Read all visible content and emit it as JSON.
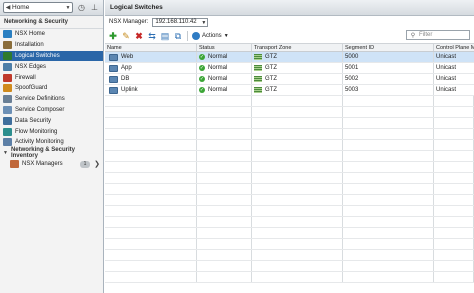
{
  "nav": {
    "home_label": "Home",
    "section_title": "Networking & Security",
    "items": [
      {
        "label": "NSX Home",
        "icon": "nsx-home-icon",
        "color": "#2a7fc1"
      },
      {
        "label": "Installation",
        "icon": "installation-icon",
        "color": "#8a6d3b"
      },
      {
        "label": "Logical Switches",
        "icon": "logical-switches-icon",
        "color": "#2e7a2e"
      },
      {
        "label": "NSX Edges",
        "icon": "nsx-edges-icon",
        "color": "#4d7ea8"
      },
      {
        "label": "Firewall",
        "icon": "firewall-icon",
        "color": "#c0392b"
      },
      {
        "label": "SpoofGuard",
        "icon": "spoofguard-icon",
        "color": "#d08a1c"
      },
      {
        "label": "Service Definitions",
        "icon": "service-definitions-icon",
        "color": "#6a7f95"
      },
      {
        "label": "Service Composer",
        "icon": "service-composer-icon",
        "color": "#6c8fb5"
      },
      {
        "label": "Data Security",
        "icon": "data-security-icon",
        "color": "#3f6e9c"
      },
      {
        "label": "Flow Monitoring",
        "icon": "flow-monitoring-icon",
        "color": "#2c8e8e"
      },
      {
        "label": "Activity Monitoring",
        "icon": "activity-monitoring-icon",
        "color": "#5c7fa6"
      }
    ],
    "selected_index": 2,
    "inventory": {
      "title": "Networking & Security Inventory",
      "item_label": "NSX Managers",
      "item_count": "1"
    }
  },
  "main": {
    "title": "Logical Switches",
    "manager_label": "NSX Manager:",
    "manager_value": "192.168.110.42",
    "actions_label": "Actions",
    "filter_placeholder": "Filter",
    "columns": [
      "Name",
      "Status",
      "Transport Zone",
      "Segment ID",
      "Control Plane M"
    ],
    "rows": [
      {
        "name": "Web",
        "status": "Normal",
        "zone": "GTZ",
        "segment": "5000",
        "control": "Unicast"
      },
      {
        "name": "App",
        "status": "Normal",
        "zone": "GTZ",
        "segment": "5001",
        "control": "Unicast"
      },
      {
        "name": "DB",
        "status": "Normal",
        "zone": "GTZ",
        "segment": "5002",
        "control": "Unicast"
      },
      {
        "name": "Uplink",
        "status": "Normal",
        "zone": "GTZ",
        "segment": "5003",
        "control": "Unicast"
      }
    ],
    "selected_row": 0
  }
}
